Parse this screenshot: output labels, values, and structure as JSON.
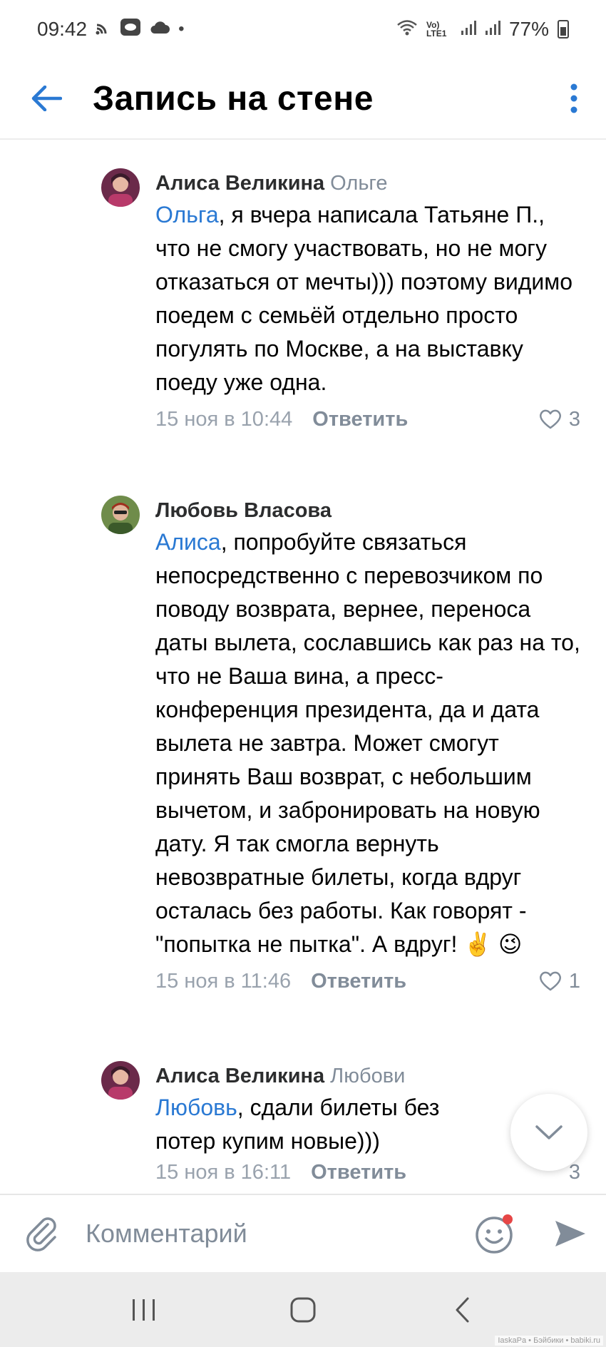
{
  "status_bar": {
    "time": "09:42",
    "signal_label": "Vo) LTE1",
    "battery": "77%"
  },
  "header": {
    "title": "Запись на стене",
    "back_icon": "arrow-left-icon",
    "menu_icon": "more-vertical-icon"
  },
  "comments": [
    {
      "author": "Алиса Великина",
      "reply_to": "Ольге",
      "mention": "Ольга",
      "text": ", я вчера написала Татьяне П., что не смогу участвовать, но не могу отказаться от мечты))) поэтому видимо поедем с семьёй отдельно просто погулять по Москве,  а на выставку поеду уже одна.",
      "date": "15 ноя в 10:44",
      "reply_label": "Ответить",
      "likes": "3"
    },
    {
      "author": "Любовь Власова",
      "reply_to": "",
      "mention": "Алиса",
      "text": ", попробуйте связаться непосредственно с перевозчиком по поводу возврата, вернее, переноса даты вылета, сославшись как раз на то, что не Ваша вина, а пресс-конференция президента, да и дата вылета не завтра. Может смогут принять Ваш возврат, с небольшим вычетом, и забронировать на новую дату. Я так смогла вернуть невозвратные билеты, когда вдруг осталась без работы. Как говорят - \"попытка не пытка\". А вдруг! ✌️ 😉",
      "date": "15 ноя в 11:46",
      "reply_label": "Ответить",
      "likes": "1"
    },
    {
      "author": "Алиса Великина",
      "reply_to": "Любови",
      "mention": "Любовь",
      "text": ", сдали билеты без потер купим новые)))",
      "date": "15 ноя в 16:11",
      "reply_label": "Ответить",
      "likes": "3"
    }
  ],
  "composer": {
    "placeholder": "Комментарий"
  },
  "watermark": "IaskaPa • Бэйбики • babiki.ru",
  "colors": {
    "accent": "#2a79d3",
    "secondary_text": "#818c99",
    "notification_dot": "#e64646"
  }
}
